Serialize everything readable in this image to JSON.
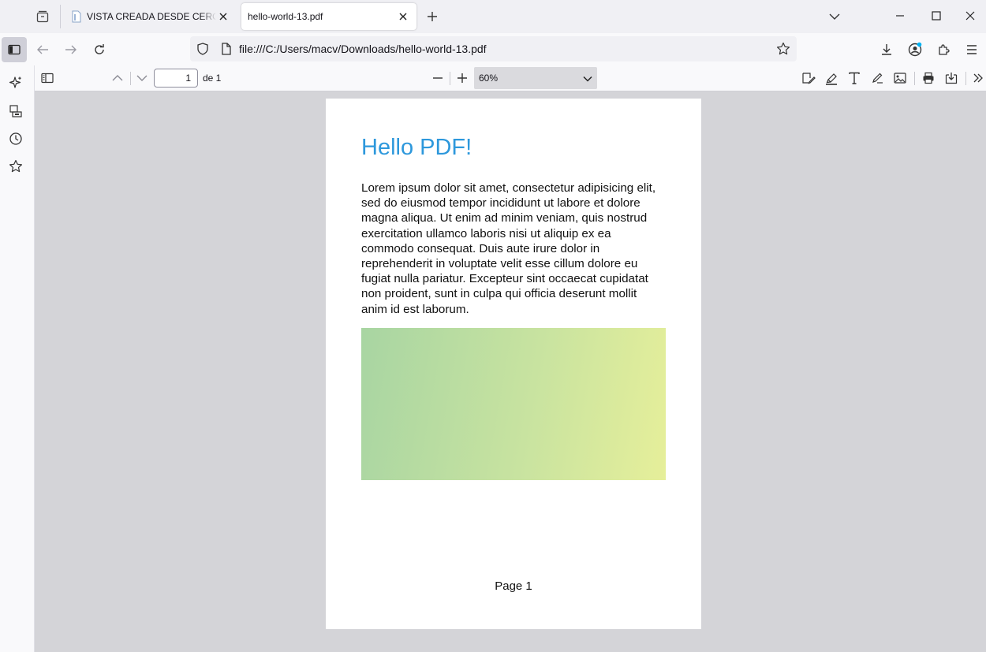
{
  "tabs": [
    {
      "title": "VISTA CREADA DESDE CERO - Visual Basic",
      "active": false
    },
    {
      "title": "hello-world-13.pdf",
      "active": true
    }
  ],
  "urlbar": {
    "url": "file:///C:/Users/macv/Downloads/hello-world-13.pdf"
  },
  "pdf_toolbar": {
    "page_number": "1",
    "page_of": "de 1",
    "zoom": "60%"
  },
  "document": {
    "heading": "Hello PDF!",
    "paragraph": "Lorem ipsum dolor sit amet, consectetur adipisicing elit, sed do eiusmod tempor incididunt ut labore et dolore magna aliqua. Ut enim ad minim veniam, quis nostrud exercitation ullamco laboris nisi ut aliquip ex ea commodo consequat. Duis aute irure dolor in reprehenderit in voluptate velit esse cillum dolore eu fugiat nulla pariatur. Excepteur sint occaecat cupidatat non proident, sunt in culpa qui officia deserunt mollit anim id est laborum.",
    "footer": "Page 1"
  },
  "colors": {
    "heading": "#2d98dc",
    "gradient_start": "#a8d5a2",
    "gradient_end": "#e6ef9a",
    "accent_dot": "#00b3f4"
  },
  "icons": [
    "tab-overview-icon",
    "document-favicon",
    "close-icon",
    "plus-icon",
    "chevron-down-icon",
    "minimize-icon",
    "maximize-icon",
    "window-close-icon",
    "sidebar-icon",
    "back-arrow-icon",
    "forward-arrow-icon",
    "reload-icon",
    "shield-icon",
    "page-icon",
    "bookmark-star-icon",
    "download-icon",
    "account-icon",
    "extensions-icon",
    "menu-icon",
    "ai-sparkle-icon",
    "synced-tabs-icon",
    "history-icon",
    "bookmarks-icon",
    "pdf-sidebar-icon",
    "page-up-icon",
    "page-down-icon",
    "zoom-out-icon",
    "zoom-in-icon",
    "signature-icon",
    "highlight-icon",
    "text-icon",
    "draw-icon",
    "image-icon",
    "print-icon",
    "save-icon",
    "more-tools-icon"
  ]
}
